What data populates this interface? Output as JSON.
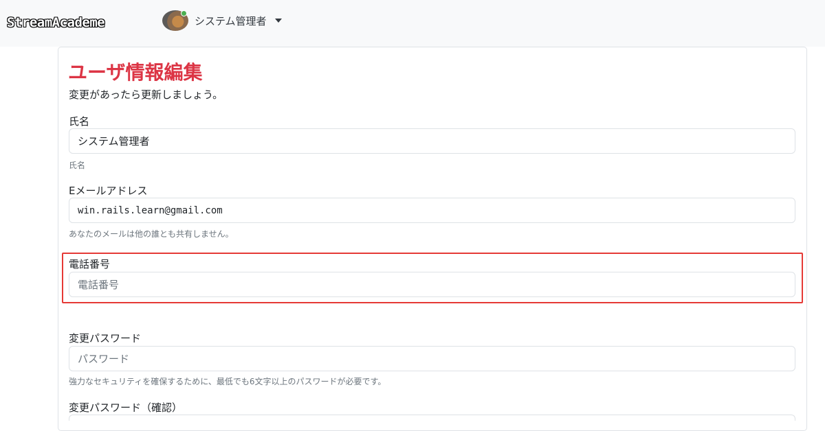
{
  "navbar": {
    "brand": "StreamAcademe",
    "user_name": "システム管理者"
  },
  "page": {
    "title": "ユーザ情報編集",
    "lead": "変更があったら更新しましょう。"
  },
  "form": {
    "name": {
      "label": "氏名",
      "value": "システム管理者",
      "help": "氏名"
    },
    "email": {
      "label": "Eメールアドレス",
      "value": "win.rails.learn@gmail.com",
      "help": "あなたのメールは他の誰とも共有しません。"
    },
    "phone": {
      "label": "電話番号",
      "placeholder": "電話番号"
    },
    "password": {
      "label": "変更パスワード",
      "placeholder": "パスワード",
      "help": "強力なセキュリティを確保するために、最低でも6文字以上のパスワードが必要です。"
    },
    "password_confirm": {
      "label": "変更パスワード（確認）"
    }
  },
  "colors": {
    "title": "#dc3545",
    "highlight": "#e53935",
    "online": "#4caf50"
  }
}
